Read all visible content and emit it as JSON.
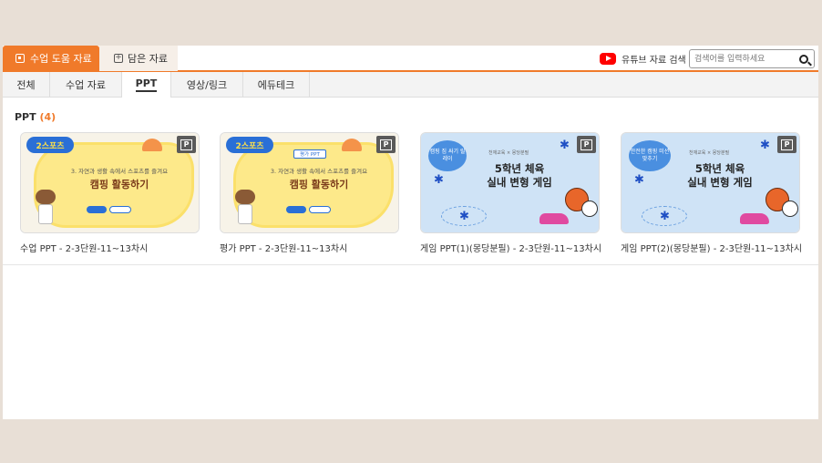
{
  "top_tabs": {
    "main_label": "수업 도움 자료",
    "saved_label": "담은 자료"
  },
  "youtube": {
    "label": "유튜브 자료 검색"
  },
  "search": {
    "placeholder": "검색어를 입력하세요"
  },
  "sub_tabs": [
    {
      "label": "전체"
    },
    {
      "label": "수업 자료"
    },
    {
      "label": "PPT"
    },
    {
      "label": "영상/링크"
    },
    {
      "label": "에듀테크"
    }
  ],
  "section": {
    "label": "PPT",
    "count": "(4)"
  },
  "badge_letter": "P",
  "cards": [
    {
      "title": "수업 PPT - 2-3단원-11~13차시",
      "slide": {
        "logo": "2스포츠",
        "subtitle": "3. 자연과 생활 속에서 스포츠를 즐겨요",
        "main": "캠핑 활동하기"
      }
    },
    {
      "title": "평가 PPT - 2-3단원-11~13차시",
      "slide": {
        "logo": "2스포츠",
        "tag": "평가 PPT",
        "subtitle": "3. 자연과 생활 속에서 스포츠를 즐겨요",
        "main": "캠핑 활동하기"
      }
    },
    {
      "title": "게임 PPT(1)(몽당분필) - 2-3단원-11~13차시",
      "slide": {
        "bubble": "캠핑 짐 싸기 릴레이",
        "brand": "천재교육 × 몽당분필",
        "line1": "5학년 체육",
        "line2": "실내 변형 게임"
      }
    },
    {
      "title": "게임 PPT(2)(몽당분필) - 2-3단원-11~13차시",
      "slide": {
        "bubble": "안전한 캠핑 미션 맞추기",
        "brand": "천재교육 × 몽당분필",
        "line1": "5학년 체육",
        "line2": "실내 변형 게임"
      }
    }
  ],
  "colors": {
    "accent": "#f07a2a",
    "blue": "#2a6fd6"
  },
  "icons": [
    "document-icon",
    "plus-box-icon",
    "youtube-icon",
    "search-icon",
    "ppt-badge-icon"
  ]
}
